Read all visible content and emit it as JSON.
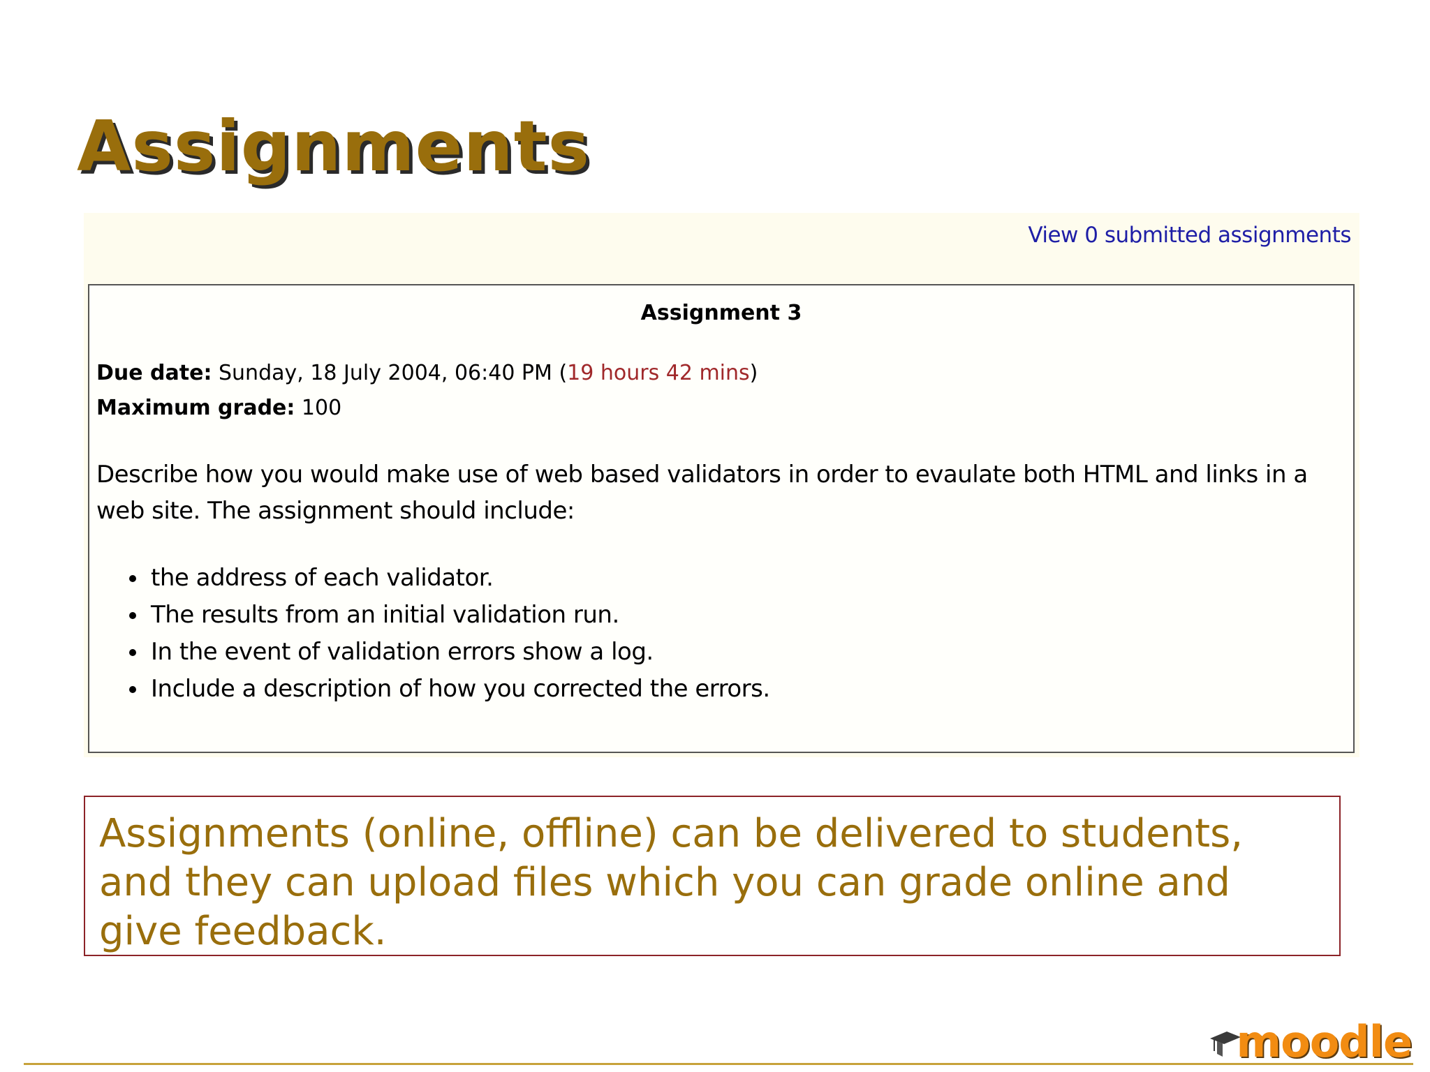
{
  "slide": {
    "title": "Assignments"
  },
  "screenshot": {
    "view_link": "View 0 submitted assignments",
    "assignment": {
      "title": "Assignment 3",
      "due_label": "Due date:",
      "due_value": " Sunday, 18 July 2004, 06:40 PM (",
      "due_remaining": "19 hours 42 mins",
      "due_close": ")",
      "grade_label": "Maximum grade:",
      "grade_value": " 100",
      "description": "Describe how you would make use of web based validators in order to evaulate both HTML and links in a web site. The assignment should include:",
      "requirements": [
        "the address of each validator.",
        "The results from an initial validation run.",
        "In the event of validation errors show a log.",
        "Include a description of how you corrected the errors."
      ]
    }
  },
  "caption": "Assignments (online, offline) can be delivered to students, and they can upload files which you can grade online and give feedback.",
  "logo": {
    "text": "moodle",
    "icon": "mortarboard-icon"
  },
  "colors": {
    "title": "#996e0c",
    "link": "#1e1ea6",
    "remaining": "#a0282a",
    "caption_border": "#8c2328",
    "footer_line": "#c7a23b",
    "logo": "#f28c12"
  }
}
